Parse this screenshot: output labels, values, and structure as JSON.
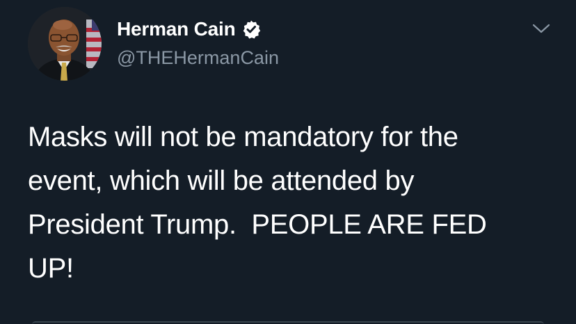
{
  "tweet": {
    "author": {
      "display_name": "Herman Cain",
      "handle": "@THEHermanCain",
      "verified": true,
      "avatar_icon": "profile-photo"
    },
    "text": "Masks will not be mandatory for the\nevent, which will be attended by\nPresident Trump.  PEOPLE ARE FED\nUP!",
    "menu_icon": "chevron-down-icon"
  },
  "colors": {
    "background": "#141d27",
    "text": "#ffffff",
    "handle": "#8b98a5",
    "verified_badge": "#ffffff",
    "chevron": "#8b98a5"
  }
}
